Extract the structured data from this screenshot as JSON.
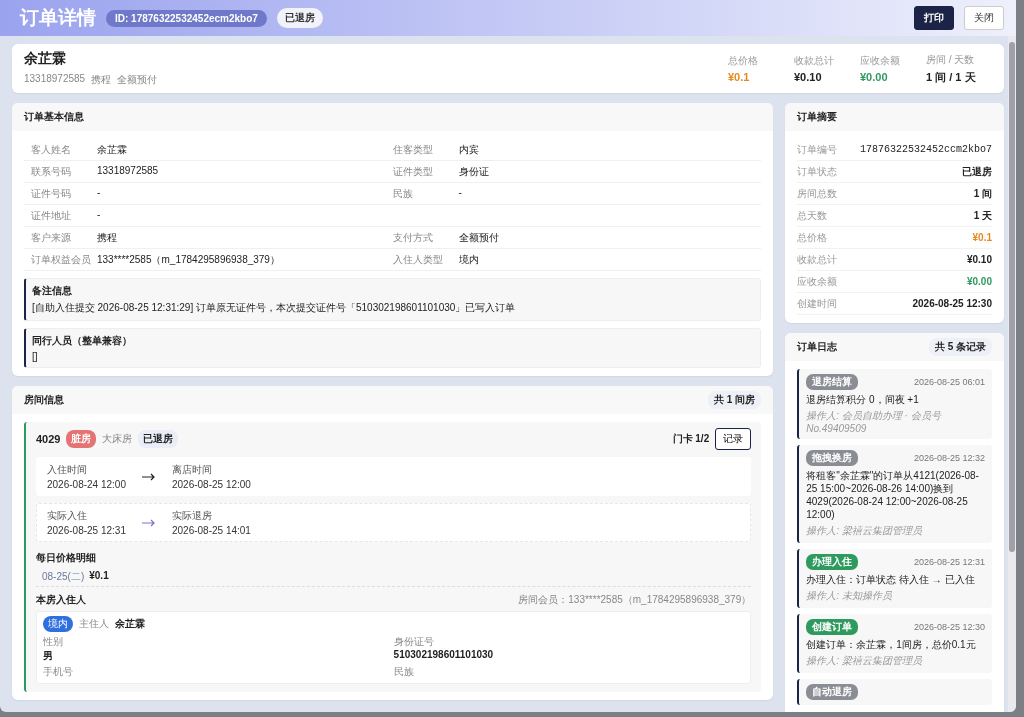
{
  "header": {
    "title": "订单详情",
    "id_badge": "ID: 17876322532452ecm2kbo7",
    "status_badge": "已退房",
    "buttons": [
      {
        "label": "打印",
        "kind": "primary"
      },
      {
        "label": "关闭",
        "kind": "secondary"
      }
    ]
  },
  "guest": {
    "name": "余芷霖",
    "meta": [
      "13318972585",
      "携程",
      "全额预付"
    ],
    "stats": [
      {
        "label": "总价格",
        "value": "¥0.1",
        "kind": "warn"
      },
      {
        "label": "收款总计",
        "value": "¥0.10",
        "kind": "plain"
      },
      {
        "label": "应收余额",
        "value": "¥0.00",
        "kind": "ok"
      },
      {
        "label": "房间 / 天数",
        "value": "1 间 / 1 天",
        "kind": "plain"
      }
    ]
  },
  "basic_info": {
    "title": "订单基本信息",
    "rows": [
      [
        {
          "label": "客人姓名",
          "value": "余芷霖"
        },
        {
          "label": "住客类型",
          "value": "内宾"
        }
      ],
      [
        {
          "label": "联系号码",
          "value": "13318972585"
        },
        {
          "label": "证件类型",
          "value": "身份证"
        }
      ],
      [
        {
          "label": "证件号码",
          "value": "-"
        },
        {
          "label": "民族",
          "value": "-"
        }
      ],
      [
        {
          "label": "证件地址",
          "value": "-"
        }
      ],
      [
        {
          "label": "客户来源",
          "value": "携程"
        },
        {
          "label": "支付方式",
          "value": "全额预付"
        }
      ],
      [
        {
          "label": "订单权益会员",
          "value": "133****2585（m_1784295896938_379）"
        },
        {
          "label": "入住人类型",
          "value": "境内"
        }
      ]
    ],
    "notes": [
      {
        "title": "备注信息",
        "text": "[自助入住提交 2026-08-25 12:31:29] 订单原无证件号，本次提交证件号「510302198601101030」已写入订单"
      },
      {
        "title": "同行人员（整单兼容）",
        "text": "[]"
      }
    ]
  },
  "room_info": {
    "title": "房间信息",
    "count": "共 1 间房",
    "room": {
      "number": "4029",
      "dirty_tag": "脏房",
      "type": "大床房",
      "status": "已退房",
      "card": "门卡 1/2",
      "record_button": "记录",
      "times": [
        {
          "kind": "planned",
          "from_label": "入住时间",
          "from": "2026-08-24 12:00",
          "to_label": "离店时间",
          "to": "2026-08-25 12:00"
        },
        {
          "kind": "actual",
          "from_label": "实际入住",
          "from": "2026-08-25 12:31",
          "to_label": "实际退房",
          "to": "2026-08-25 14:01"
        }
      ],
      "price_title": "每日价格明细",
      "prices": [
        {
          "date": "08-25(二)",
          "price": "¥0.1"
        }
      ],
      "guests_title": "本房入住人",
      "room_member": "房间会员：133****2585（m_1784295896938_379）",
      "guests": [
        {
          "region": "境内",
          "role": "主住人",
          "name": "余芷霖",
          "fields": [
            {
              "label": "性别",
              "value": "男"
            },
            {
              "label": "身份证号",
              "value": "510302198601101030"
            },
            {
              "label": "手机号"
            },
            {
              "label": "民族"
            }
          ]
        }
      ]
    }
  },
  "summary": {
    "title": "订单摘要",
    "rows": [
      {
        "label": "订单编号",
        "value": "17876322532452ccm2kbo7",
        "kind": "mono"
      },
      {
        "label": "订单状态",
        "value": "已退房",
        "kind": "plain"
      },
      {
        "label": "房间总数",
        "value": "1 间",
        "kind": "plain"
      },
      {
        "label": "总天数",
        "value": "1 天",
        "kind": "plain"
      },
      {
        "label": "总价格",
        "value": "¥0.1",
        "kind": "warn"
      },
      {
        "label": "收款总计",
        "value": "¥0.10",
        "kind": "plain"
      },
      {
        "label": "应收余额",
        "value": "¥0.00",
        "kind": "ok"
      },
      {
        "label": "创建时间",
        "value": "2026-08-25 12:30",
        "kind": "plain"
      }
    ]
  },
  "log": {
    "title": "订单日志",
    "count": "共 5 条记录",
    "entries": [
      {
        "tag": "退房结算",
        "color": "#8a8d94",
        "time": "2026-08-25 06:01",
        "text": "退房结算积分 0，间夜 +1",
        "operator": "操作人: 会员自助办理 · 会员号No.49409509"
      },
      {
        "tag": "拖拽换房",
        "color": "#8a8d94",
        "time": "2026-08-25 12:32",
        "text": "将租客\"余芷霖\"的订单从4121(2026-08-25 15:00~2026-08-26 14:00)换到4029(2026-08-24 12:00~2026-08-25 12:00)",
        "operator": "操作人: 梁禧云集团管理员"
      },
      {
        "tag": "办理入住",
        "color": "#2e9a5e",
        "time": "2026-08-25 12:31",
        "text": "办理入住：订单状态 待入住 → 已入住",
        "operator": "操作人: 未知操作员"
      },
      {
        "tag": "创建订单",
        "color": "#2e9a5e",
        "time": "2026-08-25 12:30",
        "text": "创建订单：余芷霖，1间房，总价0.1元",
        "operator": "操作人: 梁禧云集团管理员"
      },
      {
        "tag": "自动退房",
        "color": "#8a8d94"
      }
    ]
  }
}
